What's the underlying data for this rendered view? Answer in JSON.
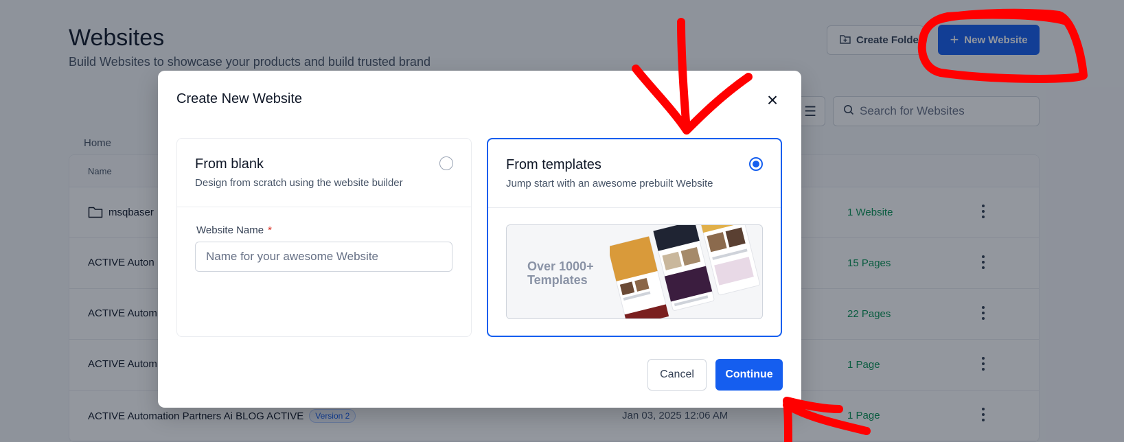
{
  "page": {
    "title": "Websites",
    "subtitle": "Build Websites to showcase your products and build trusted brand",
    "create_folder_label": "Create Folder",
    "new_website_label": "New Website",
    "search_placeholder": "Search for Websites",
    "breadcrumb": "Home",
    "table": {
      "column_name": "Name",
      "rows": [
        {
          "name": "msqbaser",
          "count": "1 Website",
          "date": ""
        },
        {
          "name": "ACTIVE Auton",
          "count": "15 Pages",
          "date": ""
        },
        {
          "name": "ACTIVE Autom",
          "count": "22 Pages",
          "date": ""
        },
        {
          "name": "ACTIVE Autom",
          "count": "1 Page",
          "date": ""
        },
        {
          "name": "ACTIVE Automation Partners Ai BLOG ACTIVE",
          "badge": "Version 2",
          "date": "Jan 03, 2025 12:06 AM",
          "count": "1 Page"
        }
      ]
    }
  },
  "modal": {
    "title": "Create New Website",
    "close_icon": "close-icon",
    "blank": {
      "title": "From blank",
      "description": "Design from scratch using the website builder",
      "field_label": "Website Name",
      "required_mark": "*",
      "input_placeholder": "Name for your awesome Website",
      "input_value": ""
    },
    "templates": {
      "title": "From templates",
      "description": "Jump start with an awesome prebuilt Website",
      "preview_text_line1": "Over 1000+",
      "preview_text_line2": "Templates",
      "selected": true
    },
    "cancel_label": "Cancel",
    "continue_label": "Continue"
  },
  "colors": {
    "primary": "#155eef",
    "success_text": "#079455",
    "annotation": "#ff0000"
  }
}
